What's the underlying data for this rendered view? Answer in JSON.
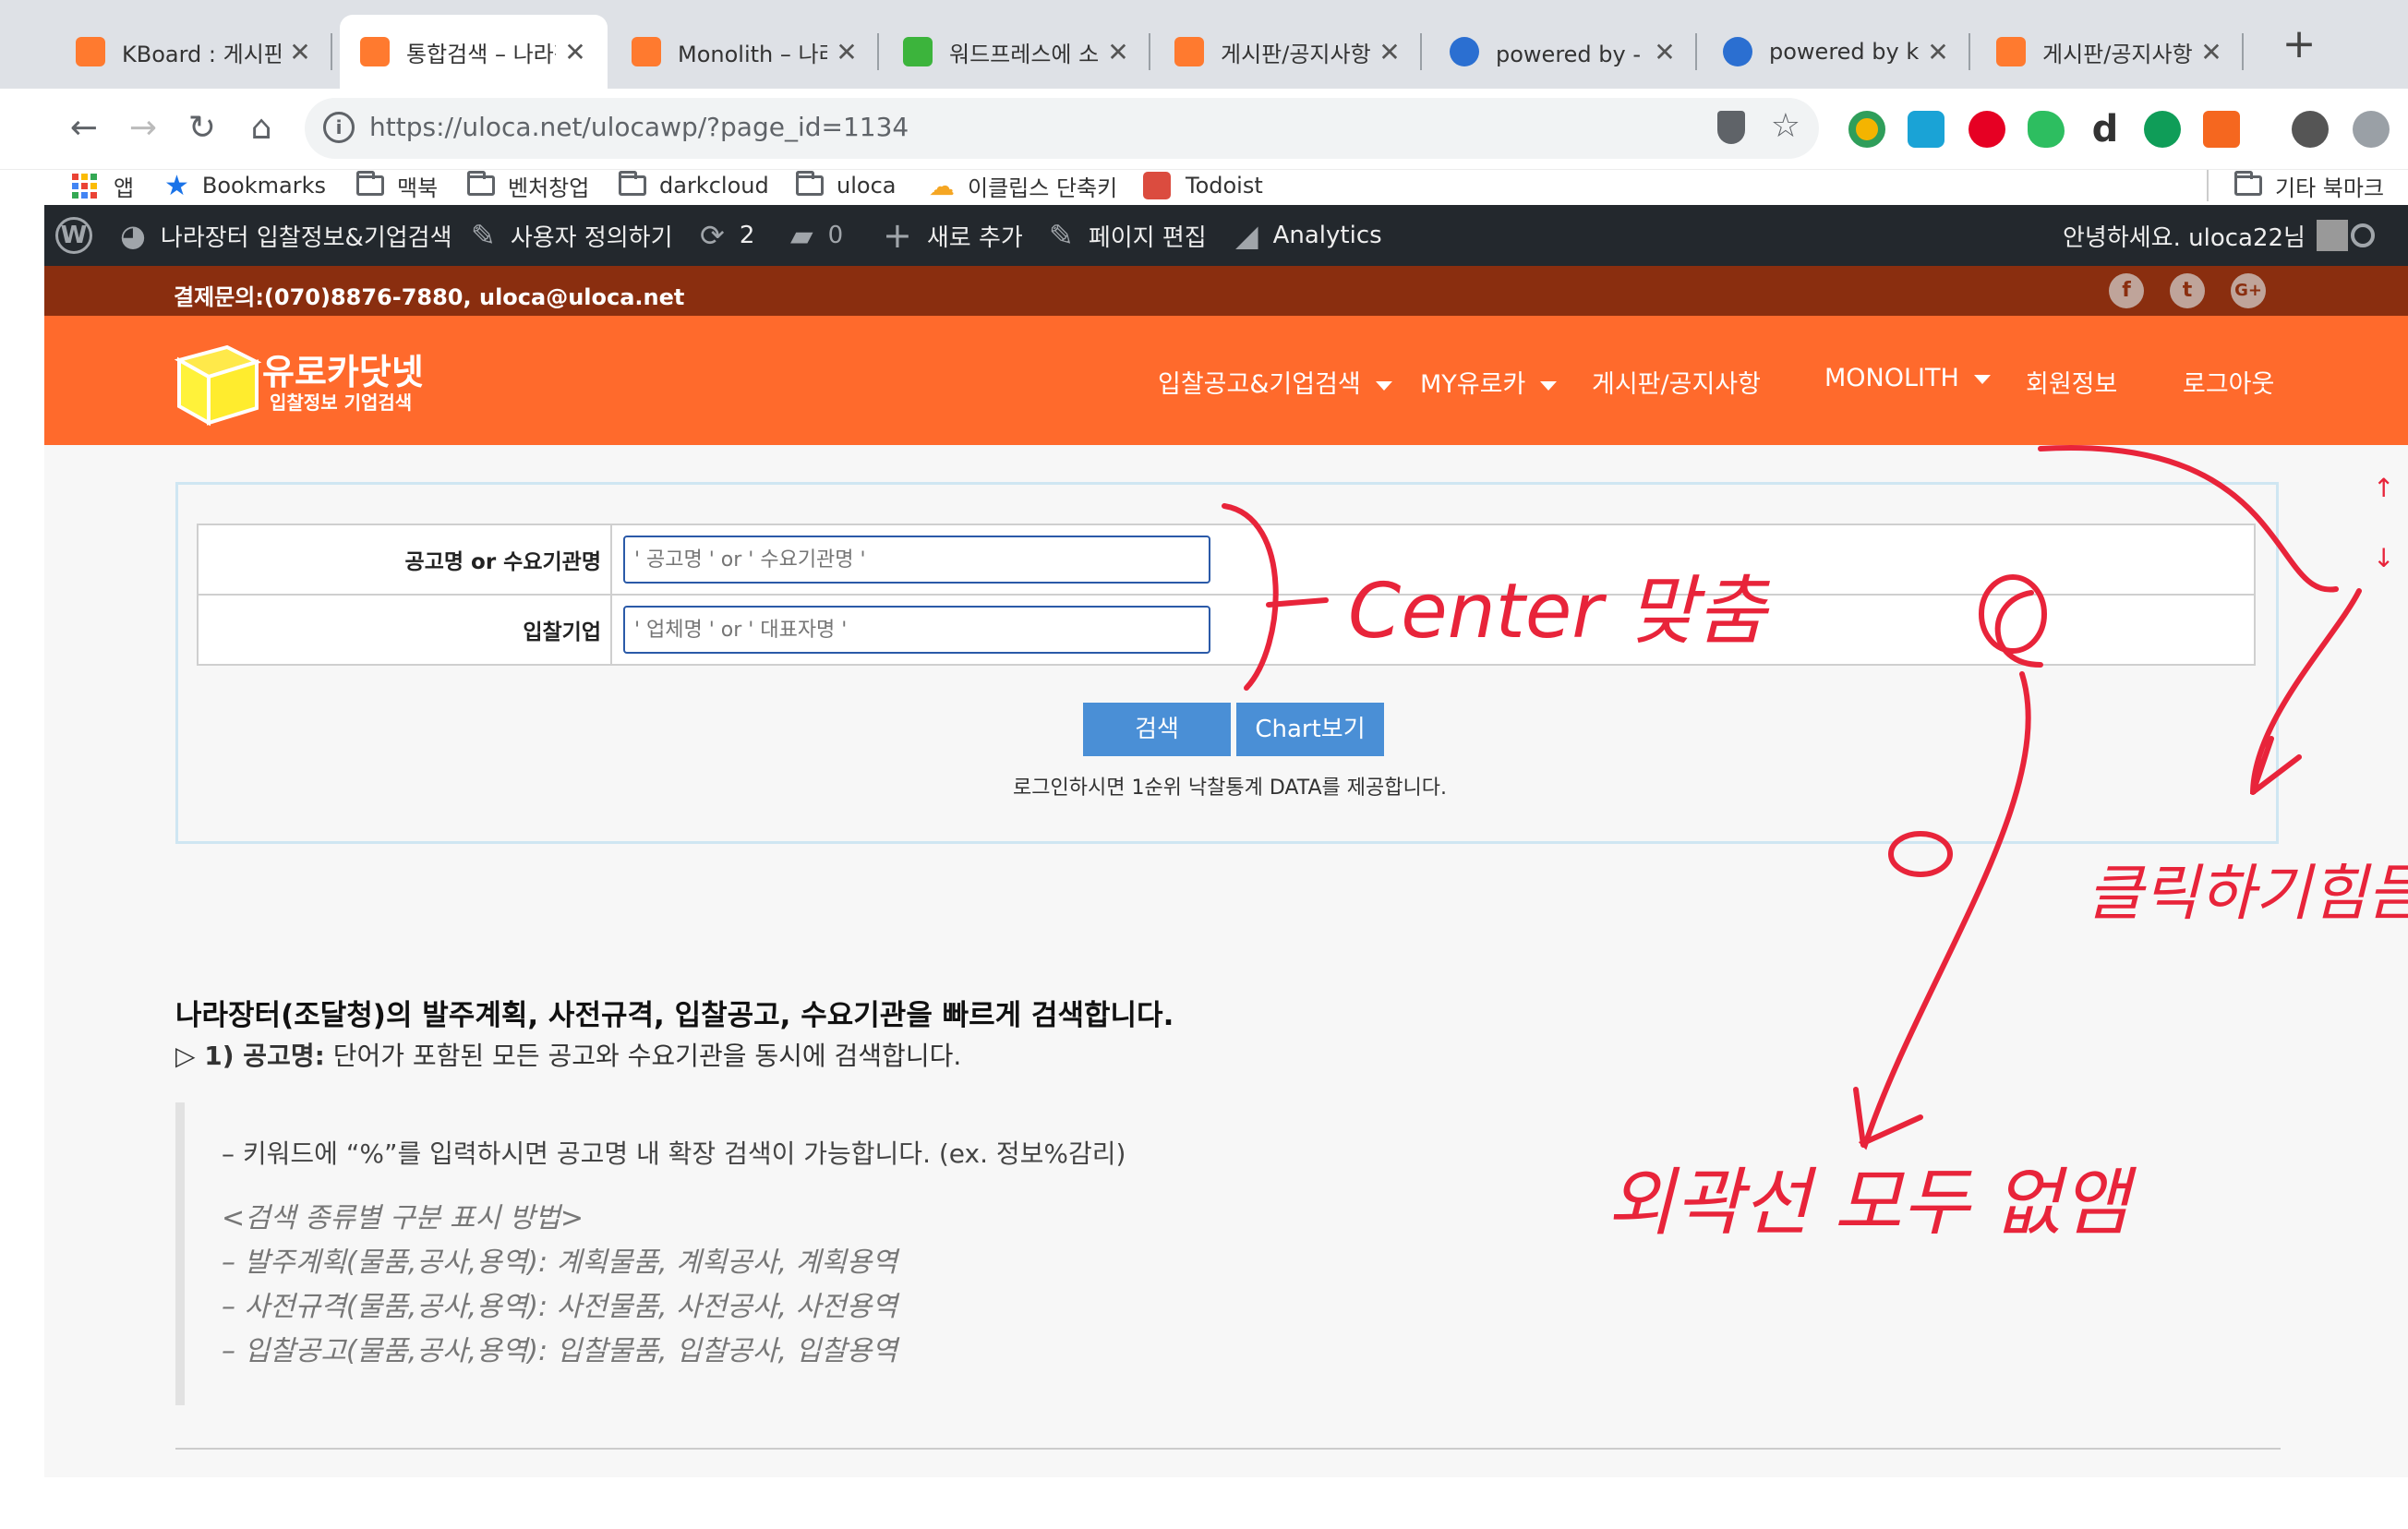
{
  "browser": {
    "tabs": [
      {
        "title": "KBoard : 게시판",
        "favicon_color": "#ff7a2f"
      },
      {
        "title": "통합검색 – 나라장",
        "favicon_color": "#ff7a2f",
        "active": true
      },
      {
        "title": "Monolith – 나라",
        "favicon_color": "#ff7a2f"
      },
      {
        "title": "워드프레스에 소설",
        "favicon_color": "#3cb43c"
      },
      {
        "title": "게시판/공지사항 –",
        "favicon_color": "#ff7a2f"
      },
      {
        "title": "powered by - 즈",
        "favicon_color": "#2b6fd1"
      },
      {
        "title": "powered by kb",
        "favicon_color": "#2b6fd1"
      },
      {
        "title": "게시판/공지사항 –",
        "favicon_color": "#ff7a2f"
      }
    ],
    "url": "https://uloca.net/ulocawp/?page_id=1134",
    "bookmarks": [
      "앱",
      "Bookmarks",
      "맥북",
      "벤처창업",
      "darkcloud",
      "uloca",
      "이클립스 단축키",
      "Todoist"
    ],
    "other_bookmarks": "기타 북마크"
  },
  "wp_admin": {
    "site_name": "나라장터 입찰정보&기업검색",
    "customize": "사용자 정의하기",
    "updates_count": "2",
    "comments_count": "0",
    "new": "새로 추가",
    "edit_page": "페이지 편집",
    "analytics": "Analytics",
    "greeting": "안녕하세요. uloca22님"
  },
  "site": {
    "contact": "결제문의:(070)8876-7880, uloca@uloca.net",
    "social": [
      "f",
      "t",
      "G+"
    ],
    "logo_title": "유로카닷넷",
    "logo_subtitle": "입찰정보 기업검색",
    "menu": [
      "입찰공고&기업검색",
      "MY유로카",
      "게시판/공지사항",
      "MONOLITH",
      "회원정보",
      "로그아웃"
    ]
  },
  "search": {
    "label1": "공고명 or 수요기관명",
    "placeholder1": "' 공고명 ' or ' 수요기관명 '",
    "label2": "입찰기업",
    "placeholder2": "' 업체명 ' or ' 대표자명 '",
    "search_btn": "검색",
    "chart_btn": "Chart보기",
    "note": "로그인하시면 1순위 낙찰통계 DATA를 제공합니다."
  },
  "article": {
    "headline": "나라장터(조달청)의 발주계획, 사전규격, 입찰공고, 수요기관을 빠르게 검색합니다.",
    "sub_prefix": "▷ 1) 공고명:",
    "sub_text": " 단어가 포함된 모든 공고와 수요기관을 동시에 검색합니다.",
    "quote_line": "– 키워드에 “%”를 입력하시면 공고명 내 확장 검색이 가능합니다. (ex. 정보%감리)",
    "quote_items": [
      "<검색 종류별 구분 표시 방법>",
      "– 발주계획(물품,공사,용역): 계획물품, 계획공사, 계획용역",
      "– 사전규격(물품,공사,용역): 사전물품, 사전공사, 사전용역",
      "– 입찰공고(물품,공사,용역): 입찰물품, 입찰공사, 입찰용역"
    ]
  },
  "annotations": {
    "center": "Center 맞춤",
    "remove_border": "외곽선 모두 없앰",
    "hard_to_click": "클릭하기힘듬",
    "color": "#e8243a"
  }
}
